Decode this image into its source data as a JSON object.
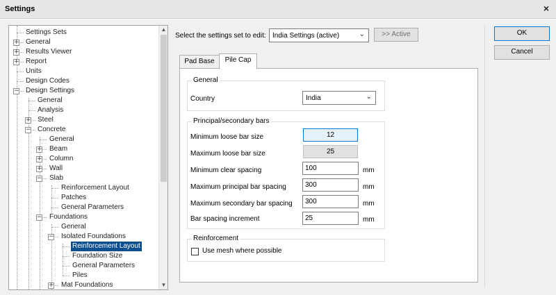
{
  "window": {
    "title": "Settings",
    "close_glyph": "×"
  },
  "tree": {
    "items": [
      {
        "label": "Settings Sets"
      },
      {
        "label": "General",
        "expander": "+"
      },
      {
        "label": "Results Viewer",
        "expander": "+"
      },
      {
        "label": "Report",
        "expander": "+"
      },
      {
        "label": "Units"
      },
      {
        "label": "Design Codes"
      },
      {
        "label": "Design Settings",
        "expander": "−"
      },
      {
        "label": "General"
      },
      {
        "label": "Analysis"
      },
      {
        "label": "Steel",
        "expander": "+"
      },
      {
        "label": "Concrete",
        "expander": "−"
      },
      {
        "label": "General"
      },
      {
        "label": "Beam",
        "expander": "+"
      },
      {
        "label": "Column",
        "expander": "+"
      },
      {
        "label": "Wall",
        "expander": "+"
      },
      {
        "label": "Slab",
        "expander": "−"
      },
      {
        "label": "Reinforcement Layout"
      },
      {
        "label": "Patches"
      },
      {
        "label": "General Parameters"
      },
      {
        "label": "Foundations",
        "expander": "−"
      },
      {
        "label": "General"
      },
      {
        "label": "Isolated Foundations",
        "expander": "−"
      },
      {
        "label": "Reinforcement Layout",
        "selected": true
      },
      {
        "label": "Foundation Size"
      },
      {
        "label": "General Parameters"
      },
      {
        "label": "Piles"
      },
      {
        "label": "Mat Foundations",
        "expander": "+"
      }
    ]
  },
  "settings_set": {
    "label": "Select the settings set to edit:",
    "value": "India Settings (active)",
    "active_button": ">> Active"
  },
  "buttons": {
    "ok": "OK",
    "cancel": "Cancel"
  },
  "tabs": [
    {
      "label": "Pad Base",
      "active": false
    },
    {
      "label": "Pile Cap",
      "active": true
    }
  ],
  "general_group": {
    "title": "General",
    "country_label": "Country",
    "country_value": "India"
  },
  "bars_group": {
    "title": "Principal/secondary bars",
    "fields": [
      {
        "label": "Minimum loose bar size",
        "value": "12",
        "unit": ""
      },
      {
        "label": "Maximum loose bar size",
        "value": "25",
        "unit": ""
      },
      {
        "label": "Minimum clear spacing",
        "value": "100",
        "unit": "mm"
      },
      {
        "label": "Maximum principal bar spacing",
        "value": "300",
        "unit": "mm"
      },
      {
        "label": "Maximum secondary bar spacing",
        "value": "300",
        "unit": "mm"
      },
      {
        "label": "Bar spacing increment",
        "value": "25",
        "unit": "mm"
      }
    ]
  },
  "reinforcement_group": {
    "title": "Reinforcement",
    "checkbox_label": "Use mesh where possible",
    "checked": false
  },
  "icons": {
    "chevron": "chevron-down-icon",
    "scroll_up": "scroll-up-icon",
    "scroll_down": "scroll-down-icon"
  },
  "colors": {
    "selection": "#0c4f8f",
    "focus_border": "#0078d7"
  }
}
